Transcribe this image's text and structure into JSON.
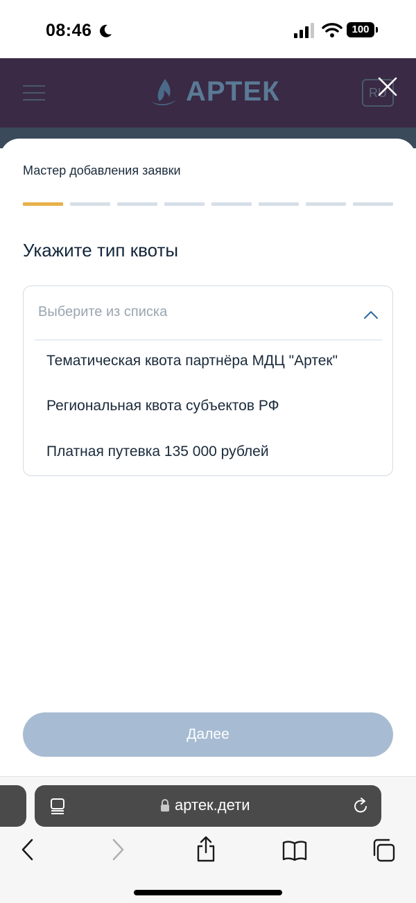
{
  "status_bar": {
    "time": "08:46",
    "battery": "100"
  },
  "site_header": {
    "logo_text": "АРТЕК",
    "lang": "RU"
  },
  "modal": {
    "wizard_title": "Мастер добавления заявки",
    "progress": {
      "total_steps": 8,
      "current_step": 1
    },
    "question": "Укажите тип квоты",
    "dropdown": {
      "placeholder": "Выберите из списка",
      "options": [
        "Тематическая квота партнёра МДЦ \"Артек\"",
        "Региональная квота субъектов РФ",
        "Платная путевка 135 000 рублей"
      ]
    },
    "next_label": "Далее"
  },
  "browser": {
    "url": "артек.дети"
  },
  "colors": {
    "progress_active": "#e8b04a",
    "progress_inactive": "#d6dfe8",
    "next_button_disabled": "#a7bcd3",
    "accent": "#2a6aa0"
  }
}
